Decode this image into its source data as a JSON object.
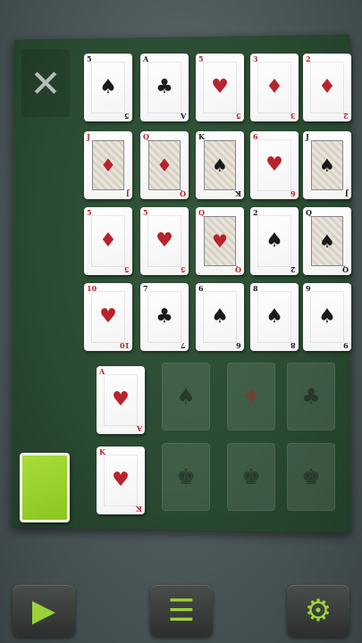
{
  "close": {
    "glyph": "✕",
    "icon": "close-icon"
  },
  "tableau": [
    [
      {
        "rank": "5",
        "suit": "♠",
        "color": "black"
      },
      {
        "rank": "A",
        "suit": "♣",
        "color": "black"
      },
      {
        "rank": "5",
        "suit": "♥",
        "color": "red"
      },
      {
        "rank": "3",
        "suit": "♦",
        "color": "red"
      },
      {
        "rank": "2",
        "suit": "♦",
        "color": "red"
      }
    ],
    [
      {
        "rank": "J",
        "suit": "♦",
        "color": "red",
        "face": true
      },
      {
        "rank": "Q",
        "suit": "♦",
        "color": "red",
        "face": true
      },
      {
        "rank": "K",
        "suit": "♠",
        "color": "black",
        "face": true
      },
      {
        "rank": "6",
        "suit": "♥",
        "color": "red"
      },
      {
        "rank": "J",
        "suit": "♠",
        "color": "black",
        "face": true
      }
    ],
    [
      {
        "rank": "5",
        "suit": "♦",
        "color": "red"
      },
      {
        "rank": "5",
        "suit": "♥",
        "color": "red"
      },
      {
        "rank": "Q",
        "suit": "♥",
        "color": "red",
        "face": true
      },
      {
        "rank": "2",
        "suit": "♠",
        "color": "black"
      },
      {
        "rank": "Q",
        "suit": "♠",
        "color": "black",
        "face": true
      }
    ],
    [
      {
        "rank": "10",
        "suit": "♥",
        "color": "red"
      },
      {
        "rank": "7",
        "suit": "♣",
        "color": "black"
      },
      {
        "rank": "6",
        "suit": "♠",
        "color": "black"
      },
      {
        "rank": "8",
        "suit": "♠",
        "color": "black"
      },
      {
        "rank": "9",
        "suit": "♠",
        "color": "black"
      }
    ]
  ],
  "foundation_aces": {
    "card": {
      "rank": "A",
      "suit": "♥",
      "color": "red"
    },
    "ghosts": [
      "♠",
      "♦",
      "♣"
    ]
  },
  "foundation_kings": {
    "card": {
      "rank": "K",
      "suit": "♥",
      "color": "red"
    },
    "ghosts": [
      "♚",
      "♚",
      "♚"
    ]
  },
  "controls": {
    "play_glyph": "▶",
    "menu_glyph": "☰",
    "settings_glyph": "⚙"
  }
}
